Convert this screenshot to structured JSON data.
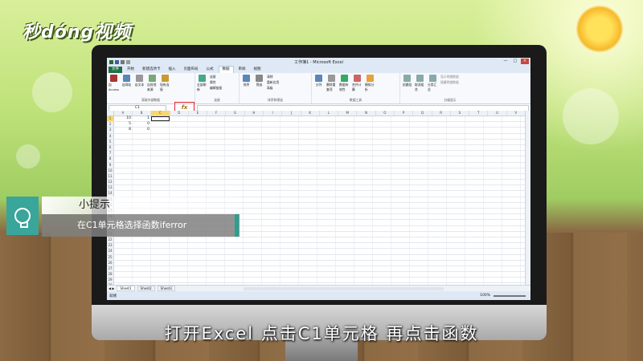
{
  "branding": {
    "logo": "秒dóng视频"
  },
  "excel": {
    "window_title": "工作簿1 - Microsoft Excel",
    "window_buttons": [
      "—",
      "□",
      "×"
    ],
    "tabs": [
      "文件",
      "开始",
      "新建选项卡",
      "插入",
      "页面布局",
      "公式",
      "数据",
      "审阅",
      "视图"
    ],
    "active_tab": "数据",
    "ribbon_groups": [
      {
        "label": "获取外部数据",
        "buttons": [
          "自 Access",
          "自网站",
          "自文本",
          "自其他来源",
          "现有连接"
        ]
      },
      {
        "label": "连接",
        "buttons": [
          "全部刷新",
          "连接",
          "属性",
          "编辑链接"
        ]
      },
      {
        "label": "排序和筛选",
        "buttons": [
          "排序",
          "筛选",
          "清除",
          "重新应用",
          "高级"
        ]
      },
      {
        "label": "数据工具",
        "buttons": [
          "分列",
          "删除重复项",
          "数据有效性",
          "合并计算",
          "模拟分析"
        ]
      },
      {
        "label": "分级显示",
        "buttons": [
          "创建组",
          "取消组合",
          "分类汇总",
          "显示明细数据",
          "隐藏明细数据"
        ]
      }
    ],
    "name_box": "C1",
    "fx_label": "fx",
    "columns": [
      "A",
      "B",
      "C",
      "D",
      "E",
      "F",
      "G",
      "H",
      "I",
      "J",
      "K",
      "L",
      "M",
      "N",
      "O",
      "P",
      "Q",
      "R",
      "S",
      "T",
      "U",
      "V"
    ],
    "rows": [
      [
        "10",
        "1",
        ""
      ],
      [
        "5",
        "0",
        ""
      ],
      [
        "8",
        "0",
        ""
      ]
    ],
    "row_count": 35,
    "sheets": [
      "Sheet1",
      "Sheet2",
      "Sheet3"
    ],
    "status_left": "就绪",
    "zoom": "100%"
  },
  "tip": {
    "title": "小提示",
    "body": "在C1单元格选择函数iferror"
  },
  "caption": "打开Excel 点击C1单元格 再点击函数"
}
